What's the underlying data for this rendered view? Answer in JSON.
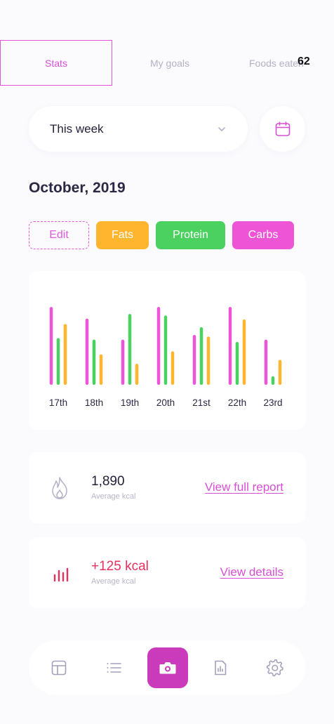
{
  "tabs": [
    {
      "label": "Stats",
      "active": true
    },
    {
      "label": "My goals",
      "active": false
    },
    {
      "label": "Foods eaten",
      "active": false
    }
  ],
  "tab_badge": "62",
  "period": {
    "label": "This week"
  },
  "month": "October, 2019",
  "chips": {
    "edit": "Edit",
    "fats": "Fats",
    "protein": "Protein",
    "carbs": "Carbs"
  },
  "colors": {
    "accent": "#d84fd6",
    "fats": "#ffb52e",
    "protein": "#4bd15f",
    "carbs": "#ee55d6",
    "negative": "#e8305e"
  },
  "chart_data": {
    "type": "bar",
    "categories": [
      "17th",
      "18th",
      "19th",
      "20th",
      "21st",
      "22th",
      "23rd"
    ],
    "series": [
      {
        "name": "Carbs",
        "color": "#ee55d6",
        "values": [
          100,
          85,
          58,
          100,
          64,
          100,
          58
        ]
      },
      {
        "name": "Protein",
        "color": "#4bd15f",
        "values": [
          60,
          58,
          91,
          89,
          74,
          55,
          11
        ]
      },
      {
        "name": "Fats",
        "color": "#ffb52e",
        "values": [
          78,
          39,
          27,
          43,
          62,
          84,
          32
        ]
      }
    ],
    "ylim": [
      0,
      110
    ]
  },
  "kcal_card": {
    "value": "1,890",
    "sub": "Average kcal",
    "link": "View full report",
    "icon": "flame-icon"
  },
  "diff_card": {
    "value": "+125 kcal",
    "sub": "Average kcal",
    "link": "View details",
    "icon": "bar-chart-icon"
  },
  "nav": {
    "items": [
      "dashboard-icon",
      "list-icon",
      "camera-icon",
      "report-icon",
      "settings-icon"
    ],
    "active": "camera-icon"
  }
}
